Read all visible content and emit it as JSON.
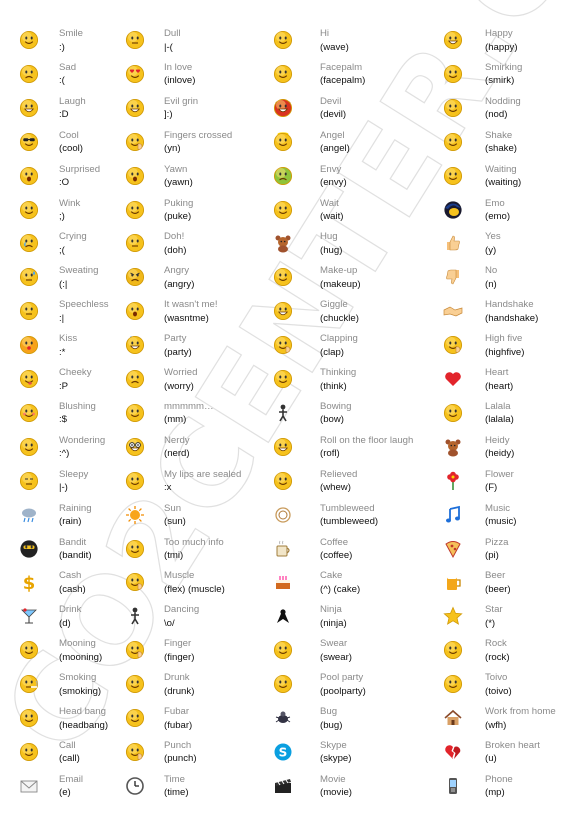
{
  "watermark": "CO2CENTER.COM",
  "colors": {
    "label": "#8a8a8a",
    "code": "#111111",
    "face": "#f6c21d"
  },
  "columns": [
    {
      "items": [
        {
          "label": "Smile",
          "code": ":)",
          "icon": "smile-icon"
        },
        {
          "label": "Sad",
          "code": ":(",
          "icon": "sad-icon"
        },
        {
          "label": "Laugh",
          "code": ":D",
          "icon": "laugh-icon"
        },
        {
          "label": "Cool",
          "code": "(cool)",
          "icon": "cool-icon"
        },
        {
          "label": "Surprised",
          "code": ":O",
          "icon": "surprised-icon"
        },
        {
          "label": "Wink",
          "code": ";)",
          "icon": "wink-icon"
        },
        {
          "label": "Crying",
          "code": ";(",
          "icon": "crying-icon"
        },
        {
          "label": "Sweating",
          "code": "(:|",
          "icon": "sweating-icon"
        },
        {
          "label": "Speechless",
          "code": ":|",
          "icon": "speechless-icon"
        },
        {
          "label": "Kiss",
          "code": ":*",
          "icon": "kiss-icon"
        },
        {
          "label": "Cheeky",
          "code": ":P",
          "icon": "cheeky-icon"
        },
        {
          "label": "Blushing",
          "code": ":$",
          "icon": "blushing-icon"
        },
        {
          "label": "Wondering",
          "code": ":^)",
          "icon": "wondering-icon"
        },
        {
          "label": "Sleepy",
          "code": "|-)",
          "icon": "sleepy-icon"
        },
        {
          "label": "Raining",
          "code": "(rain)",
          "icon": "rain-cloud-icon"
        },
        {
          "label": "Bandit",
          "code": "(bandit)",
          "icon": "bandit-icon"
        },
        {
          "label": "Cash",
          "code": "(cash)",
          "icon": "cash-icon"
        },
        {
          "label": "Drink",
          "code": "(d)",
          "icon": "drink-icon"
        },
        {
          "label": "Mooning",
          "code": "(mooning)",
          "icon": "mooning-icon"
        },
        {
          "label": "Smoking",
          "code": "(smoking)",
          "icon": "smoking-icon"
        },
        {
          "label": "Head bang",
          "code": "(headbang)",
          "icon": "headbang-icon"
        },
        {
          "label": "Call",
          "code": "(call)",
          "icon": "call-icon"
        },
        {
          "label": "Email",
          "code": "(e)",
          "icon": "envelope-icon"
        }
      ]
    },
    {
      "items": [
        {
          "label": "Dull",
          "code": "|-(",
          "icon": "dull-icon"
        },
        {
          "label": "In love",
          "code": "(inlove)",
          "icon": "inlove-icon"
        },
        {
          "label": "Evil grin",
          "code": "]:)",
          "icon": "evil-grin-icon"
        },
        {
          "label": "Fingers crossed",
          "code": "(yn)",
          "icon": "fingers-crossed-icon"
        },
        {
          "label": "Yawn",
          "code": "(yawn)",
          "icon": "yawn-icon"
        },
        {
          "label": "Puking",
          "code": "(puke)",
          "icon": "puking-icon"
        },
        {
          "label": "Doh!",
          "code": "(doh)",
          "icon": "doh-icon"
        },
        {
          "label": "Angry",
          "code": "(angry)",
          "icon": "angry-icon"
        },
        {
          "label": "It wasn't me!",
          "code": "(wasntme)",
          "icon": "wasntme-icon"
        },
        {
          "label": "Party",
          "code": "(party)",
          "icon": "party-icon"
        },
        {
          "label": "Worried",
          "code": "(worry)",
          "icon": "worried-icon"
        },
        {
          "label": "mmmmm…",
          "code": "(mm)",
          "icon": "mmm-icon"
        },
        {
          "label": "Nerdy",
          "code": "(nerd)",
          "icon": "nerdy-icon"
        },
        {
          "label": "My lips are sealed",
          "code": ":x",
          "icon": "lips-sealed-icon"
        },
        {
          "label": "Sun",
          "code": "(sun)",
          "icon": "sun-icon"
        },
        {
          "label": "Too much info",
          "code": "(tmi)",
          "icon": "tmi-icon"
        },
        {
          "label": "Muscle",
          "code": "(flex) (muscle)",
          "icon": "muscle-icon"
        },
        {
          "label": "Dancing",
          "code": "\\o/",
          "icon": "dancing-icon"
        },
        {
          "label": "Finger",
          "code": "(finger)",
          "icon": "finger-icon"
        },
        {
          "label": "Drunk",
          "code": "(drunk)",
          "icon": "drunk-icon"
        },
        {
          "label": "Fubar",
          "code": "(fubar)",
          "icon": "fubar-icon"
        },
        {
          "label": "Punch",
          "code": "(punch)",
          "icon": "punch-icon"
        },
        {
          "label": "Time",
          "code": "(time)",
          "icon": "clock-icon"
        }
      ]
    },
    {
      "items": [
        {
          "label": "Hi",
          "code": "(wave)",
          "icon": "wave-icon"
        },
        {
          "label": "Facepalm",
          "code": "(facepalm)",
          "icon": "facepalm-icon"
        },
        {
          "label": "Devil",
          "code": "(devil)",
          "icon": "devil-icon"
        },
        {
          "label": "Angel",
          "code": "(angel)",
          "icon": "angel-icon"
        },
        {
          "label": "Envy",
          "code": "(envy)",
          "icon": "envy-icon"
        },
        {
          "label": "Wait",
          "code": "(wait)",
          "icon": "wait-icon"
        },
        {
          "label": "Hug",
          "code": "(hug)",
          "icon": "teddy-bear-icon"
        },
        {
          "label": "Make-up",
          "code": "(makeup)",
          "icon": "makeup-icon"
        },
        {
          "label": "Giggle",
          "code": "(chuckle)",
          "icon": "giggle-icon"
        },
        {
          "label": "Clapping",
          "code": "(clap)",
          "icon": "clapping-icon"
        },
        {
          "label": "Thinking",
          "code": "(think)",
          "icon": "thinking-icon"
        },
        {
          "label": "Bowing",
          "code": "(bow)",
          "icon": "bowing-icon"
        },
        {
          "label": "Roll on the floor laugh",
          "code": "(rofl)",
          "icon": "rofl-icon"
        },
        {
          "label": "Relieved",
          "code": "(whew)",
          "icon": "relieved-icon"
        },
        {
          "label": "Tumbleweed",
          "code": "(tumbleweed)",
          "icon": "tumbleweed-icon"
        },
        {
          "label": "Coffee",
          "code": "(coffee)",
          "icon": "coffee-icon"
        },
        {
          "label": "Cake",
          "code": "(^) (cake)",
          "icon": "cake-icon"
        },
        {
          "label": "Ninja",
          "code": "(ninja)",
          "icon": "ninja-icon"
        },
        {
          "label": "Swear",
          "code": "(swear)",
          "icon": "swear-icon"
        },
        {
          "label": "Pool party",
          "code": "(poolparty)",
          "icon": "pool-party-icon"
        },
        {
          "label": "Bug",
          "code": "(bug)",
          "icon": "bug-icon"
        },
        {
          "label": "Skype",
          "code": "(skype)",
          "icon": "skype-icon"
        },
        {
          "label": "Movie",
          "code": "(movie)",
          "icon": "movie-clapper-icon"
        }
      ]
    },
    {
      "items": [
        {
          "label": "Happy",
          "code": "(happy)",
          "icon": "happy-icon"
        },
        {
          "label": "Smirking",
          "code": "(smirk)",
          "icon": "smirk-icon"
        },
        {
          "label": "Nodding",
          "code": "(nod)",
          "icon": "nodding-icon"
        },
        {
          "label": "Shake",
          "code": "(shake)",
          "icon": "shake-icon"
        },
        {
          "label": "Waiting",
          "code": "(waiting)",
          "icon": "waiting-icon"
        },
        {
          "label": "Emo",
          "code": "(emo)",
          "icon": "emo-icon"
        },
        {
          "label": "Yes",
          "code": "(y)",
          "icon": "thumbs-up-icon"
        },
        {
          "label": "No",
          "code": "(n)",
          "icon": "thumbs-down-icon"
        },
        {
          "label": "Handshake",
          "code": "(handshake)",
          "icon": "handshake-icon"
        },
        {
          "label": "High five",
          "code": "(highfive)",
          "icon": "high-five-icon"
        },
        {
          "label": "Heart",
          "code": "(heart)",
          "icon": "heart-icon"
        },
        {
          "label": "Lalala",
          "code": "(lalala)",
          "icon": "lalala-icon"
        },
        {
          "label": "Heidy",
          "code": "(heidy)",
          "icon": "squirrel-icon"
        },
        {
          "label": "Flower",
          "code": "(F)",
          "icon": "flower-icon"
        },
        {
          "label": "Music",
          "code": "(music)",
          "icon": "music-note-icon"
        },
        {
          "label": "Pizza",
          "code": "(pi)",
          "icon": "pizza-icon"
        },
        {
          "label": "Beer",
          "code": "(beer)",
          "icon": "beer-icon"
        },
        {
          "label": "Star",
          "code": "(*)",
          "icon": "star-icon"
        },
        {
          "label": "Rock",
          "code": "(rock)",
          "icon": "rock-icon"
        },
        {
          "label": "Toivo",
          "code": "(toivo)",
          "icon": "toivo-icon"
        },
        {
          "label": "Work from home",
          "code": "(wfh)",
          "icon": "house-icon"
        },
        {
          "label": "Broken heart",
          "code": "(u)",
          "icon": "broken-heart-icon"
        },
        {
          "label": "Phone",
          "code": "(mp)",
          "icon": "mobile-phone-icon"
        }
      ]
    }
  ]
}
